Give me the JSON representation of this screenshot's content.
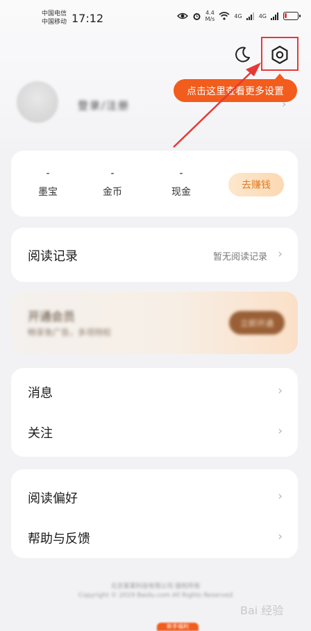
{
  "status_bar": {
    "carrier1": "中国电信",
    "carrier2": "中国移动",
    "time": "17:12",
    "speed_value": "4.4",
    "speed_unit": "M/s",
    "net1": "4G",
    "net2": "4G",
    "battery_level": 0.18
  },
  "header": {
    "tooltip": "点击这里查看更多设置",
    "icons": [
      "moon-icon",
      "gear-icon"
    ]
  },
  "profile": {
    "name": "登录/注册",
    "chevron": "›"
  },
  "assets": {
    "items": [
      {
        "value": "-",
        "label": "墨宝"
      },
      {
        "value": "-",
        "label": "金币"
      },
      {
        "value": "-",
        "label": "现金"
      }
    ],
    "earn_button": "去赚钱"
  },
  "reading": {
    "title": "阅读记录",
    "value": "暂无阅读记录",
    "chevron": "›"
  },
  "promo": {
    "title": "开通会员",
    "subtitle": "畅享免广告，多项特权",
    "button": "立即开通"
  },
  "list1": {
    "items": [
      {
        "label": "消息",
        "chevron": "›"
      },
      {
        "label": "关注",
        "chevron": "›"
      }
    ]
  },
  "list2": {
    "items": [
      {
        "label": "阅读偏好",
        "chevron": "›"
      },
      {
        "label": "帮助与反馈",
        "chevron": "›"
      }
    ]
  },
  "footer": {
    "line1": "北京某某科技有限公司 版权所有",
    "line2": "Copyright © 2019 Baidu.com All Rights Reserved",
    "watermark": "Bai 经验",
    "bottom_tag": "新手福利"
  },
  "colors": {
    "accent": "#f25c1c",
    "highlight": "#e53935",
    "earn_text": "#e07b24"
  }
}
